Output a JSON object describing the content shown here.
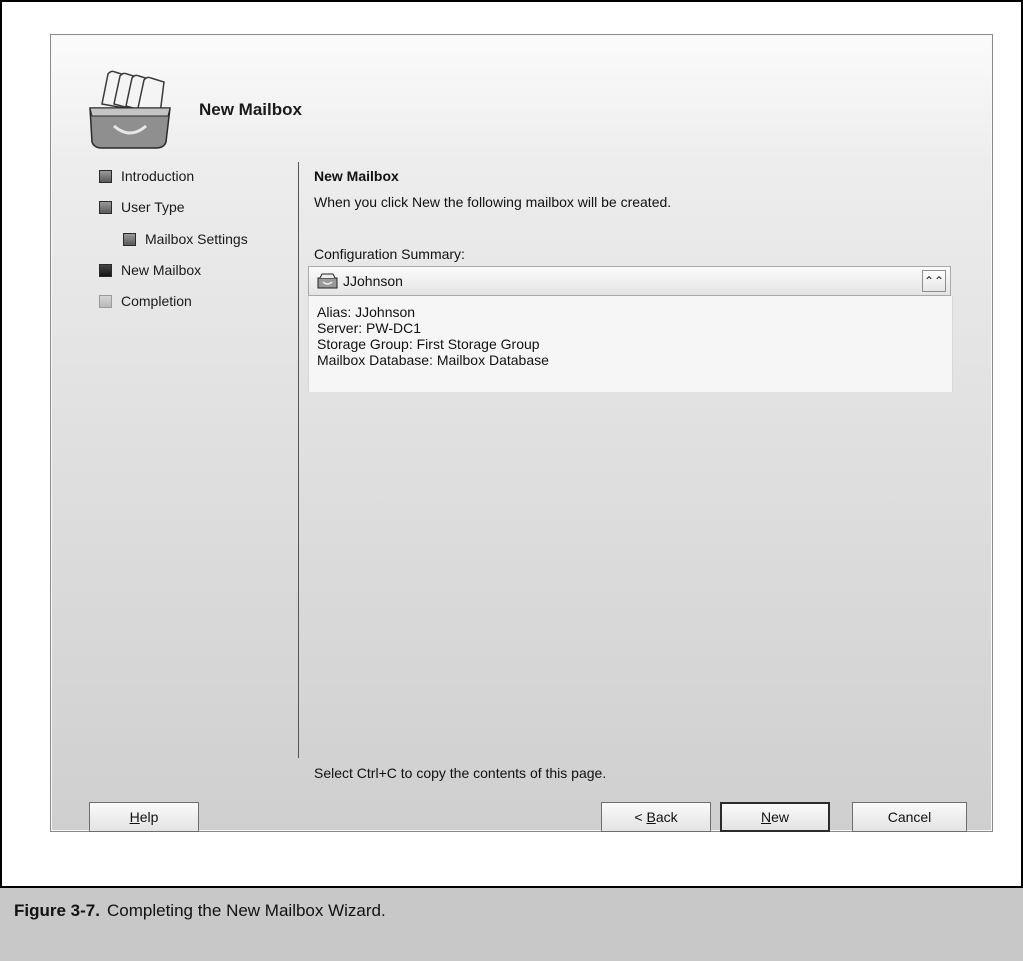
{
  "wizard": {
    "title": "New Mailbox",
    "icon": "mailbox-tray-icon"
  },
  "nav": {
    "items": [
      {
        "label": "Introduction",
        "state": "completed",
        "indent": 0
      },
      {
        "label": "User Type",
        "state": "completed",
        "indent": 0
      },
      {
        "label": "Mailbox Settings",
        "state": "completed",
        "indent": 1
      },
      {
        "label": "New Mailbox",
        "state": "current",
        "indent": 0
      },
      {
        "label": "Completion",
        "state": "pending",
        "indent": 0
      }
    ]
  },
  "content": {
    "title": "New Mailbox",
    "description": "When you click New the following mailbox will be created.",
    "summary_label": "Configuration Summary:",
    "summary": {
      "name": "JJohnson",
      "icon": "mailbox-icon",
      "collapse_icon": "double-chevron-up-icon",
      "lines": [
        "Alias: JJohnson",
        "Server: PW-DC1",
        "Storage Group: First Storage Group",
        "Mailbox Database: Mailbox Database"
      ]
    },
    "copy_hint": "Select Ctrl+C to copy the contents of this page."
  },
  "buttons": {
    "help": {
      "underlined": "H",
      "rest": "elp"
    },
    "back": {
      "prefix": "< ",
      "underlined": "B",
      "rest": "ack"
    },
    "new": {
      "underlined": "N",
      "rest": "ew"
    },
    "cancel": "Cancel"
  },
  "caption": {
    "label": "Figure 3-7.",
    "text": "Completing the New Mailbox Wizard."
  }
}
